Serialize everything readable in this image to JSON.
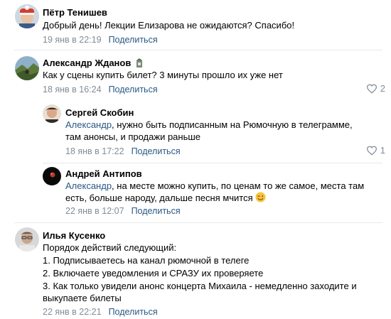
{
  "comments": [
    {
      "author": "Пётр Тенишев",
      "text": "Добрый день! Лекции Елизарова не ожидаются? Спасибо!",
      "date": "19 янв в 22:19",
      "share": "Поделиться"
    },
    {
      "author": "Александр Жданов",
      "text": "Как у сцены купить билет? 3 минуты прошло их уже нет",
      "date": "18 янв в 16:24",
      "share": "Поделиться",
      "likes": "2"
    },
    {
      "author": "Сергей Скобин",
      "mention": "Александр",
      "line1": ", нужно быть подписанным на Рюмочную в телеграмме,",
      "line2": "там анонсы, и продажи раньше",
      "date": "18 янв в 17:22",
      "share": "Поделиться",
      "likes": "1"
    },
    {
      "author": "Андрей Антипов",
      "mention": "Александр",
      "line1": ", на месте можно купить, по ценам то же самое, места там",
      "line2": "есть, больше народу, дальше песня мчится",
      "date": "22 янв в 12:07",
      "share": "Поделиться"
    },
    {
      "author": "Илья Кусенко",
      "lines": [
        "Порядок действий следующий:",
        "1. Подписываетесь на канал рюмочной в телеге",
        "2. Включаете уведомления и СРАЗУ их проверяете",
        "3. Как только увидели анонс концерта Михаила - немедленно заходите и",
        "выкупаете билеты"
      ],
      "date": "22 янв в 22:21",
      "share": "Поделиться"
    }
  ],
  "colors": {
    "link": "#2a5885",
    "meta": "#818c99",
    "divider": "#e7e8ec"
  }
}
